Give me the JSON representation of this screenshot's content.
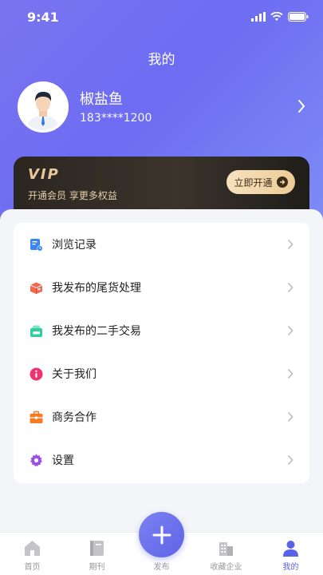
{
  "status": {
    "time": "9:41"
  },
  "header": {
    "title": "我的"
  },
  "profile": {
    "name": "椒盐鱼",
    "phone": "183****1200"
  },
  "vip": {
    "title": "VIP",
    "subtitle": "开通会员 享更多权益",
    "button_label": "立即开通"
  },
  "menu": {
    "items": [
      {
        "label": "浏览记录",
        "icon": "history-icon",
        "color": "#3a86f0"
      },
      {
        "label": "我发布的尾货处理",
        "icon": "box-icon",
        "color": "#f26a4b"
      },
      {
        "label": "我发布的二手交易",
        "icon": "second-hand-icon",
        "color": "#2fcf9d"
      },
      {
        "label": "关于我们",
        "icon": "info-icon",
        "color": "#f0336e"
      },
      {
        "label": "商务合作",
        "icon": "briefcase-icon",
        "color": "#f57a22"
      },
      {
        "label": "设置",
        "icon": "gear-icon",
        "color": "#9b4dea"
      }
    ]
  },
  "tabbar": {
    "items": [
      {
        "label": "首页",
        "icon": "home-icon"
      },
      {
        "label": "期刊",
        "icon": "book-icon"
      },
      {
        "label": "发布",
        "icon": "plus-icon"
      },
      {
        "label": "收藏企业",
        "icon": "building-icon"
      },
      {
        "label": "我的",
        "icon": "user-icon",
        "active": true
      }
    ]
  },
  "colors": {
    "accent": "#5a62e8",
    "header_start": "#7a74f0",
    "vip_gold": "#e8c89a"
  }
}
